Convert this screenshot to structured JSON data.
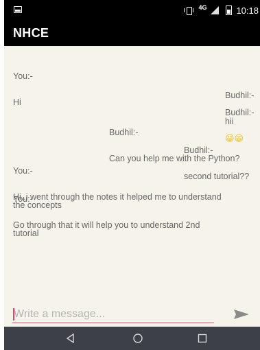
{
  "status_bar": {
    "network": "4G",
    "time": "10:18"
  },
  "app_bar": {
    "title": "NHCE"
  },
  "messages": [
    {
      "sender": "You:-",
      "text": "Hi",
      "align": "left"
    },
    {
      "sender": "Budhil:-",
      "text": "hii",
      "align": "right"
    },
    {
      "sender": "Budhil:-",
      "text": "😁😁",
      "align": "right"
    },
    {
      "sender": "Budhil:-",
      "text": "Can you help me with the Python?",
      "align": "right"
    },
    {
      "sender": "Budhil:-",
      "text": "second tutorial??",
      "align": "right"
    },
    {
      "sender": "You:-",
      "text": "Hi..i went through the notes it helped me to understand\nthe concepts",
      "align": "left"
    },
    {
      "sender": "You:-",
      "text": "Go through that it will help you to understand 2nd\ntutorial",
      "align": "left"
    }
  ],
  "composer": {
    "placeholder": "Write a message...",
    "value": ""
  },
  "colors": {
    "accent": "#e0457b",
    "bar": "#000000",
    "nav": "#3d4147",
    "background": "#f6f3ea"
  },
  "icons": [
    "image-icon",
    "vibrate-icon",
    "signal-icon",
    "battery-icon",
    "send-icon",
    "back-icon",
    "home-icon",
    "recents-icon"
  ]
}
